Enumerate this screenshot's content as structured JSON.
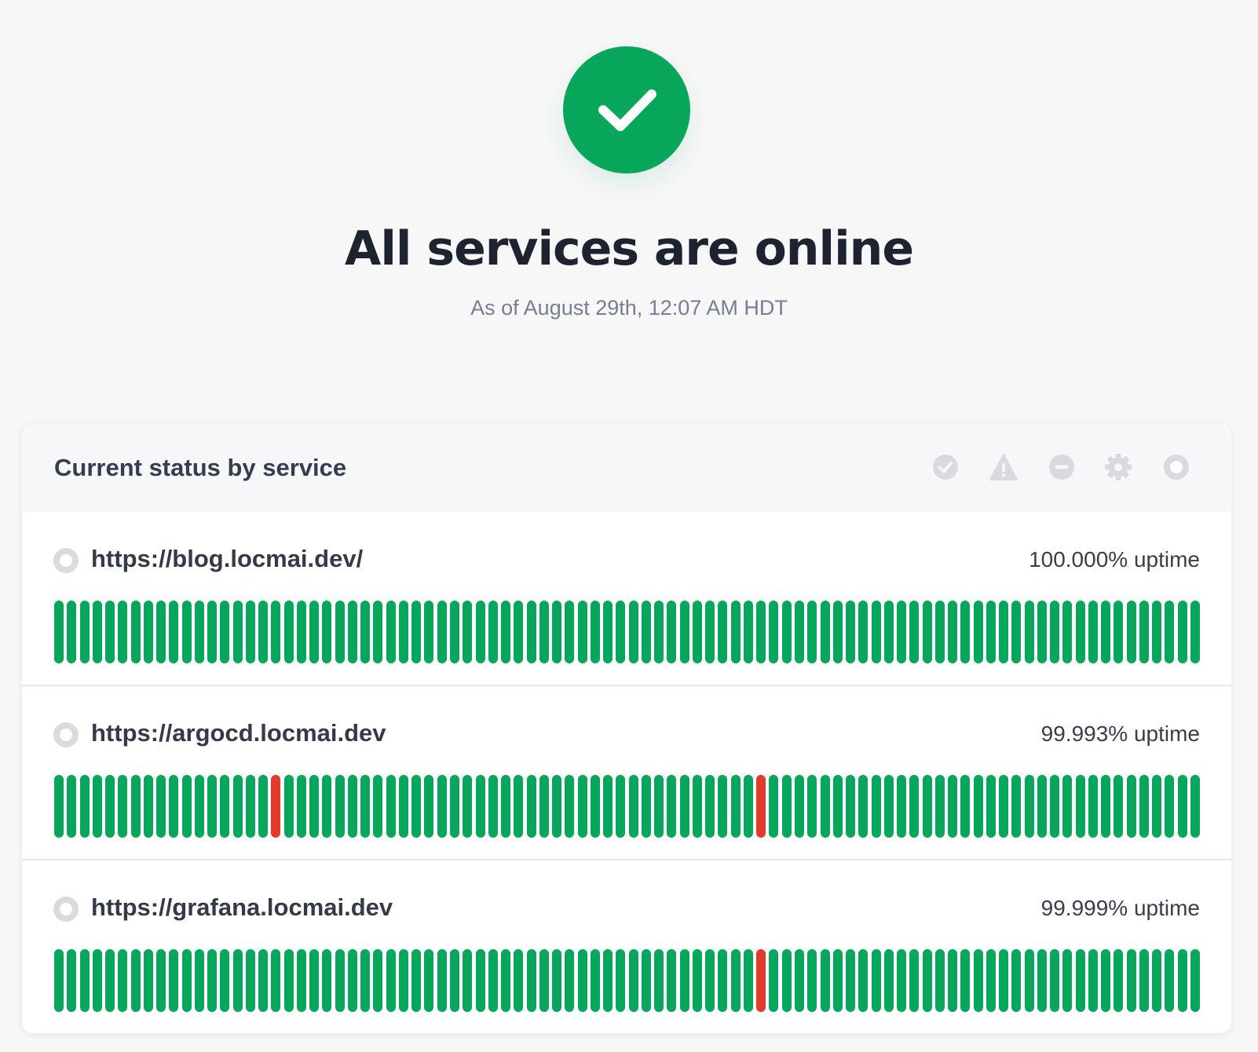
{
  "hero": {
    "status_icon": "check-icon",
    "status_color": "#07a65b",
    "title": "All services are online",
    "subtitle": "As of August 29th, 12:07 AM HDT"
  },
  "panel": {
    "title": "Current status by service",
    "legend": [
      {
        "icon": "operational-icon",
        "color": "#d8dadf"
      },
      {
        "icon": "degraded-warning-icon",
        "color": "#d8dadf"
      },
      {
        "icon": "outage-icon",
        "color": "#d8dadf"
      },
      {
        "icon": "maintenance-gear-icon",
        "color": "#d8dadf"
      },
      {
        "icon": "not-monitored-icon",
        "color": "#d8dadf"
      }
    ]
  },
  "colors": {
    "up": "#07a65b",
    "down": "#e23b2b",
    "status_dot": "#d9dbe0"
  },
  "bar_count": 90,
  "services": [
    {
      "url": "https://blog.locmai.dev/",
      "uptime_text": "100.000% uptime",
      "down_bars": []
    },
    {
      "url": "https://argocd.locmai.dev",
      "uptime_text": "99.993% uptime",
      "down_bars": [
        17,
        55
      ]
    },
    {
      "url": "https://grafana.locmai.dev",
      "uptime_text": "99.999% uptime",
      "down_bars": [
        55
      ]
    }
  ]
}
